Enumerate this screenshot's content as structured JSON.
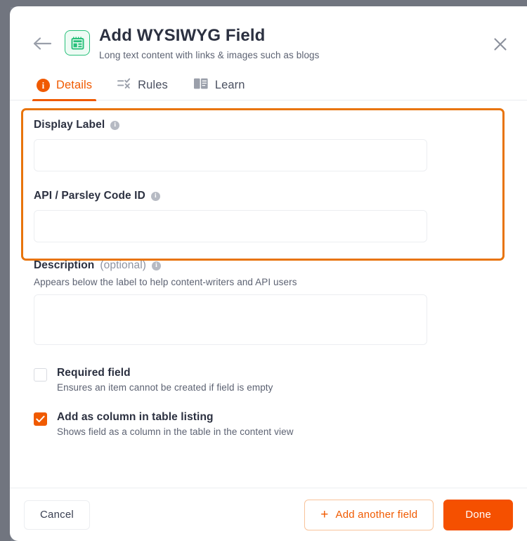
{
  "header": {
    "title": "Add WYSIWYG Field",
    "subtitle": "Long text content with links & images such as blogs",
    "back_icon": "arrow-left-icon",
    "field_type_icon": "wysiwyg-field-icon",
    "close_icon": "close-icon"
  },
  "tabs": [
    {
      "label": "Details",
      "icon": "info-circle-icon",
      "active": true
    },
    {
      "label": "Rules",
      "icon": "rules-checklist-icon",
      "active": false
    },
    {
      "label": "Learn",
      "icon": "book-icon",
      "active": false
    }
  ],
  "form": {
    "display_label": {
      "label": "Display Label",
      "info_icon": "info-icon",
      "value": "",
      "placeholder": ""
    },
    "api_code_id": {
      "label": "API / Parsley Code ID",
      "info_icon": "info-icon",
      "value": "",
      "placeholder": ""
    },
    "description": {
      "label": "Description",
      "label_optional": "(optional)",
      "info_icon": "info-icon",
      "helper": "Appears below the label to help content-writers and API users",
      "value": "",
      "placeholder": ""
    },
    "required_field": {
      "title": "Required field",
      "subtitle": "Ensures an item cannot be created if field is empty",
      "checked": false
    },
    "add_as_column": {
      "title": "Add as column in table listing",
      "subtitle": "Shows field as a column in the table in the content view",
      "checked": true
    }
  },
  "footer": {
    "cancel_label": "Cancel",
    "add_another_label": "Add another field",
    "add_another_icon": "plus-icon",
    "done_label": "Done"
  },
  "colors": {
    "accent": "#f05a00",
    "done_button": "#f55000",
    "highlight_border": "#e8740c",
    "icon_green": "#27c07a",
    "text_dark": "#2b3040",
    "text_muted": "#5c6272"
  }
}
